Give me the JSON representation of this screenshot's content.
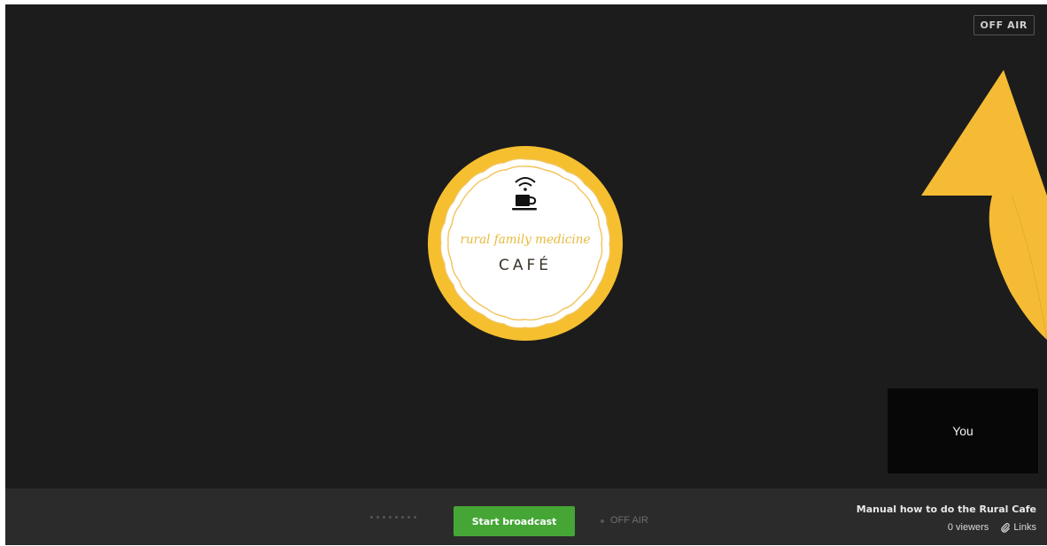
{
  "stage": {
    "status_badge": "OFF AIR",
    "logo": {
      "line1": "rural family medicine",
      "line2": "CAFÉ",
      "icon": "wifi-coffee-cup-icon",
      "colors": {
        "ring": "#f5bf2f",
        "script": "#e8b93a",
        "text": "#3a3328",
        "cup": "#111111"
      }
    },
    "annotation_arrow_color": "#f5bb34",
    "self_view_label": "You"
  },
  "control_bar": {
    "start_button_label": "Start broadcast",
    "start_button_color": "#45a636",
    "status_label": "OFF AIR",
    "audio_level_icon": "audio-level-dots"
  },
  "broadcast_meta": {
    "title": "Manual how to do the Rural Cafe",
    "viewers": "0 viewers",
    "links_label": "Links",
    "links_icon": "paperclip-icon"
  }
}
